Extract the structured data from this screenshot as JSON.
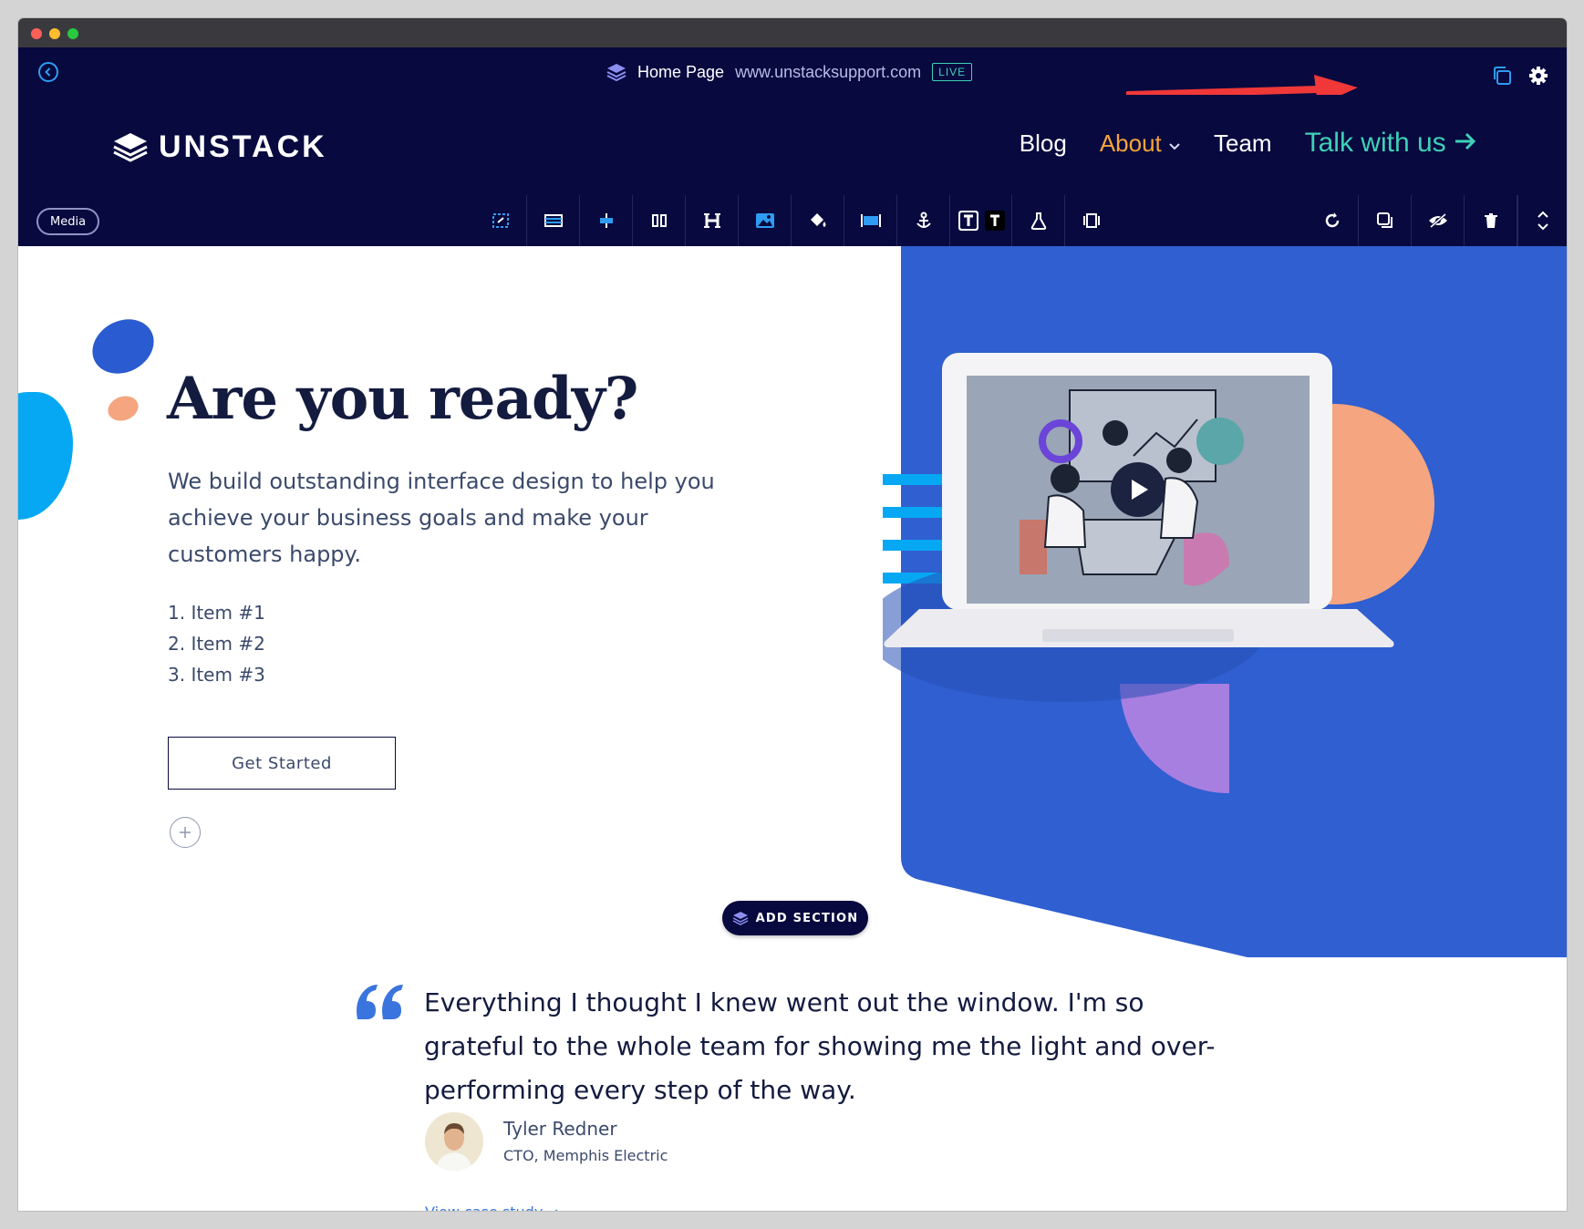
{
  "editor": {
    "page_title": "Home Page",
    "page_url": "www.unstacksupport.com",
    "status": "LIVE"
  },
  "nav": {
    "brand": "UNSTACK",
    "links": {
      "blog": "Blog",
      "about": "About",
      "team": "Team",
      "talk": "Talk with us"
    }
  },
  "toolbar": {
    "media_label": "Media"
  },
  "hero": {
    "title": "Are you ready?",
    "description": "We build outstanding interface design to help you achieve your business goals and make your customers happy.",
    "list": [
      "1. Item #1",
      "2. Item #2",
      "3. Item #3"
    ],
    "button": "Get Started"
  },
  "add_section": "ADD SECTION",
  "testimonial": {
    "quote": "Everything I thought I knew went out the window. I'm so grateful to the whole team for showing me the light and over-performing every step of the way.",
    "name": "Tyler Redner",
    "role": "CTO, Memphis Electric",
    "link": "View case study"
  },
  "colors": {
    "navy": "#07093f",
    "accent_blue": "#2f5fd0",
    "teal": "#3fd0b6",
    "orange": "#f6a43b",
    "annotation_red": "#f03838"
  }
}
